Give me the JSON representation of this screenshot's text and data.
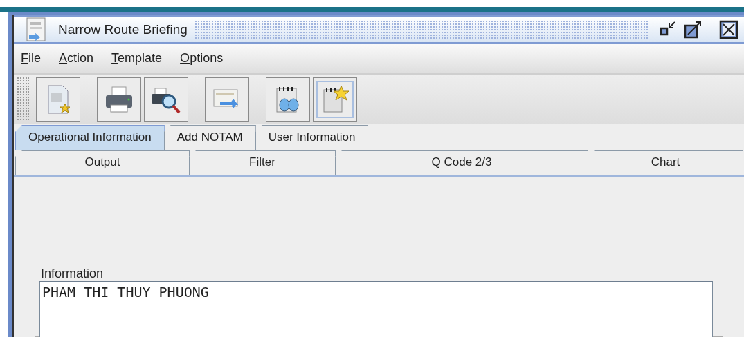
{
  "window": {
    "title": "Narrow Route Briefing"
  },
  "menu": [
    {
      "label": "File",
      "mnemonic_underlined": true
    },
    {
      "label": "Action",
      "mnemonic_underlined": true
    },
    {
      "label": "Template",
      "mnemonic_underlined": true
    },
    {
      "label": "Options",
      "mnemonic_underlined": true
    }
  ],
  "toolbar": [
    {
      "kind": "new-document",
      "selected": false
    },
    {
      "kind": "separator"
    },
    {
      "kind": "printer",
      "selected": false
    },
    {
      "kind": "print-preview",
      "selected": false
    },
    {
      "kind": "separator"
    },
    {
      "kind": "send",
      "selected": false
    },
    {
      "kind": "separator"
    },
    {
      "kind": "notepad-eyes",
      "selected": false
    },
    {
      "kind": "notepad-star",
      "selected": true
    }
  ],
  "tabs_top": [
    {
      "label": "Operational Information",
      "selected": true
    },
    {
      "label": "Add NOTAM",
      "selected": false
    },
    {
      "label": "User Information",
      "selected": false
    }
  ],
  "tabs_bottom": [
    {
      "label": "Output",
      "selected": false
    },
    {
      "label": "Filter",
      "selected": false
    },
    {
      "label": "Q Code 2/3",
      "selected": false
    },
    {
      "label": "Chart",
      "selected": false
    }
  ],
  "information": {
    "label": "Information",
    "value": "PHAM THI THUY PHUONG"
  }
}
